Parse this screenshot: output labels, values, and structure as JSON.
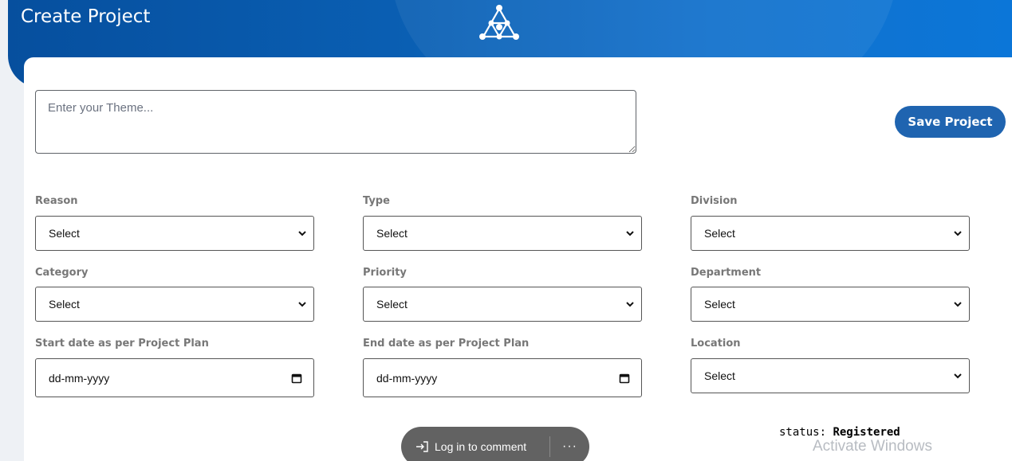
{
  "header": {
    "title": "Create Project",
    "logo_icon": "network-triangle-logo-icon"
  },
  "form": {
    "theme_placeholder": "Enter your Theme...",
    "save_label": "Save Project",
    "fields": {
      "reason": {
        "label": "Reason",
        "value": "Select"
      },
      "type": {
        "label": "Type",
        "value": "Select"
      },
      "division": {
        "label": "Division",
        "value": "Select"
      },
      "category": {
        "label": "Category",
        "value": "Select"
      },
      "priority": {
        "label": "Priority",
        "value": "Select"
      },
      "department": {
        "label": "Department",
        "value": "Select"
      },
      "start_date": {
        "label": "Start date as per Project Plan",
        "value": "dd-mm-yyyy"
      },
      "end_date": {
        "label": "End date as per Project Plan",
        "value": "dd-mm-yyyy"
      },
      "location": {
        "label": "Location",
        "value": "Select"
      }
    }
  },
  "status": {
    "label": "status:",
    "value": "Registered"
  },
  "watermark": {
    "text": "Activate Windows"
  },
  "comment_bar": {
    "login_label": "Log in to comment",
    "more_label": "···"
  },
  "colors": {
    "header_start": "#064f9e",
    "header_end": "#0b76d8",
    "button": "#1f64b0",
    "pill": "#626262"
  }
}
